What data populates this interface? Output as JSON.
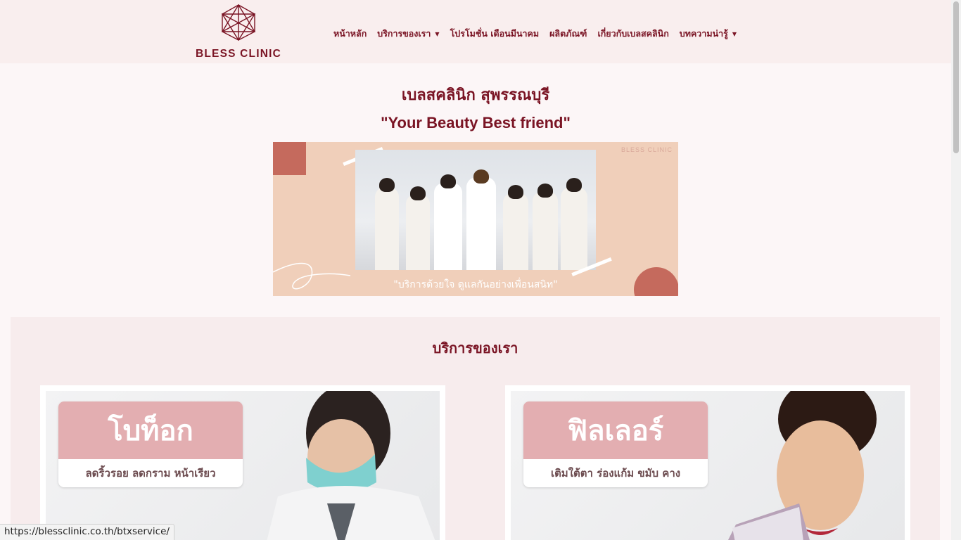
{
  "header": {
    "logo_text": "BLESS CLINIC",
    "nav": [
      {
        "label": "หน้าหลัก",
        "has_dropdown": false
      },
      {
        "label": "บริการของเรา",
        "has_dropdown": true
      },
      {
        "label": "โปรโมชั่น เดือนมีนาคม",
        "has_dropdown": false
      },
      {
        "label": "ผลิตภัณฑ์",
        "has_dropdown": false
      },
      {
        "label": "เกี่ยวกับเบลสคลินิก",
        "has_dropdown": false
      },
      {
        "label": "บทความน่ารู้",
        "has_dropdown": true
      }
    ]
  },
  "hero": {
    "title": "เบลสคลินิก สุพรรณบุรี",
    "subtitle": "\"Your Beauty Best friend\"",
    "banner_logo": "BLESS CLINIC",
    "banner_caption": "\"บริการด้วยใจ ดูแลกันอย่างเพื่อนสนิท\""
  },
  "services": {
    "title": "บริการของเรา",
    "cards": [
      {
        "name": "โบท็อก",
        "tagline": "ลดริ้วรอย ลดกราม หน้าเรียว"
      },
      {
        "name": "ฟิลเลอร์",
        "tagline": "เติมใต้ตา ร่องแก้ม ขมับ คาง"
      }
    ]
  },
  "status_bar": {
    "url": "https://blessclinic.co.th/btxservice/"
  },
  "colors": {
    "brand": "#7a1424",
    "header_bg": "#f9eeee",
    "page_bg": "#fcf6f7",
    "accent_pink": "#e3aeb1",
    "banner_bg": "#f0cfba",
    "banner_accent": "#c56a5d"
  }
}
